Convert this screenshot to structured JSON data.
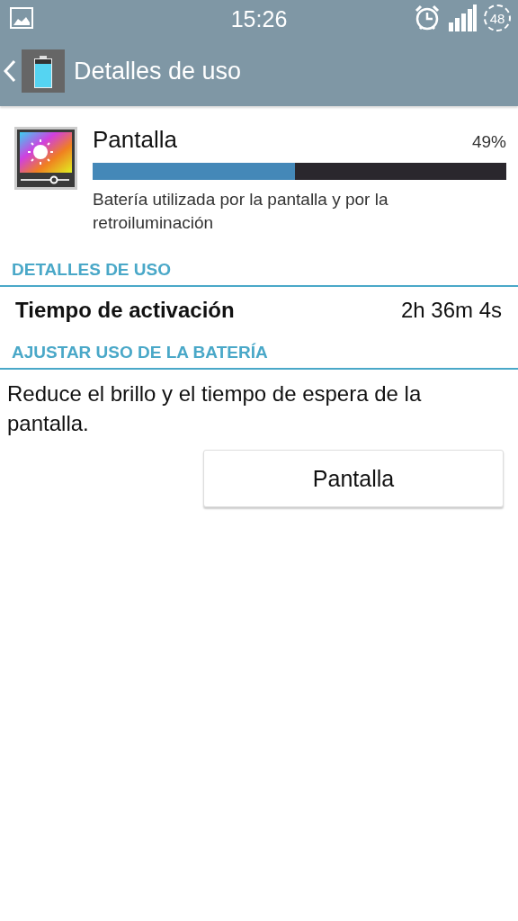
{
  "status_bar": {
    "time": "15:26",
    "battery": "48"
  },
  "action_bar": {
    "title": "Detalles de uso"
  },
  "usage_item": {
    "title": "Pantalla",
    "percent": "49%",
    "level": 0.49,
    "description": "Batería utilizada por la pantalla y por la retroiluminación"
  },
  "sections": [
    {
      "header": "DETALLES DE USO",
      "rows": [
        {
          "label": "Tiempo de activación",
          "value": "2h 36m 4s"
        }
      ]
    },
    {
      "header": "AJUSTAR USO DE LA BATERÍA",
      "text": "Reduce el brillo y el tiempo de espera de la pantalla.",
      "button": "Pantalla"
    }
  ]
}
